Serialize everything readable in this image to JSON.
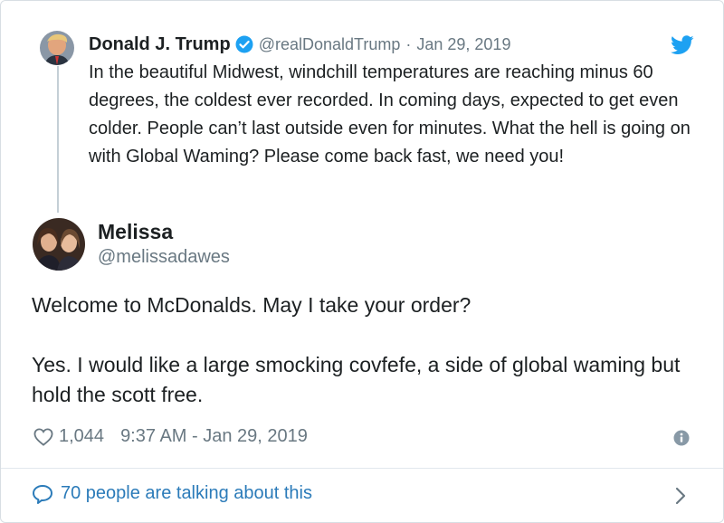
{
  "parent_tweet": {
    "name": "Donald J. Trump",
    "handle": "@realDonaldTrump",
    "separator": "·",
    "date": "Jan 29, 2019",
    "text": "In the beautiful Midwest, windchill temperatures are reaching minus 60 degrees, the coldest ever recorded. In coming days, expected to get even colder. People can’t last outside even for minutes. What the hell is going on with Global Waming? Please come back fast, we need you!"
  },
  "main_tweet": {
    "name": "Melissa",
    "handle": "@melissadawes",
    "text_line_1": "Welcome to McDonalds. May I take your order?",
    "text_line_2": "Yes. I would like a large smocking covfefe, a side of global waming but hold the scott free.",
    "likes": "1,044",
    "timestamp": "9:37 AM - Jan 29, 2019"
  },
  "footer": {
    "label": "70 people are talking about this"
  },
  "icons": {
    "verified": "verified-badge-icon",
    "brand": "twitter-bird-icon",
    "like": "heart-icon",
    "info": "info-icon",
    "reply": "speech-bubble-icon",
    "chevron": "chevron-right-icon"
  },
  "colors": {
    "twitter_blue": "#1da1f2",
    "link_blue": "#2b7bb9",
    "muted_gray": "#697882",
    "text": "#1c2022"
  }
}
